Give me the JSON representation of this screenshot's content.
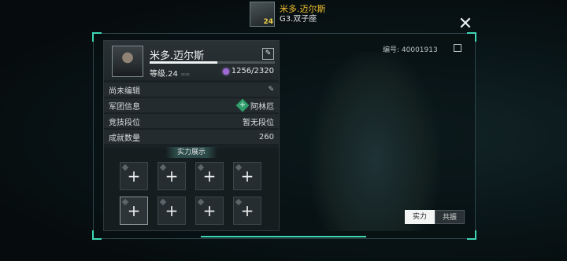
{
  "top": {
    "player_name": "米多.迈尔斯",
    "subtitle": "G3.双子座",
    "avatar_level": "24"
  },
  "close_glyph": "✕",
  "profile": {
    "name": "米多.迈尔斯",
    "edit_glyph": "✎",
    "level_label": "等级.24",
    "level_dots": "∞∞",
    "exp_text": "1256/2320",
    "exp_fraction": 0.54
  },
  "rows": [
    {
      "label": "尚未编辑",
      "value": "",
      "icon": "pencil-icon"
    },
    {
      "label": "军团信息",
      "value": "阿林厄",
      "icon": "legion-emblem-icon"
    },
    {
      "label": "竞技段位",
      "value": "暂无段位"
    },
    {
      "label": "成就数量",
      "value": "260"
    }
  ],
  "pencil_glyph": "✎",
  "showcase": {
    "title": "实力展示",
    "plus_glyph": "+"
  },
  "id_text": "编号: 40001913",
  "tabs": [
    {
      "label": "实力"
    },
    {
      "label": "共振"
    }
  ],
  "colors": {
    "accent": "#3fd6b4",
    "gem": "#a06ad6",
    "name_gold": "#f0c030"
  }
}
